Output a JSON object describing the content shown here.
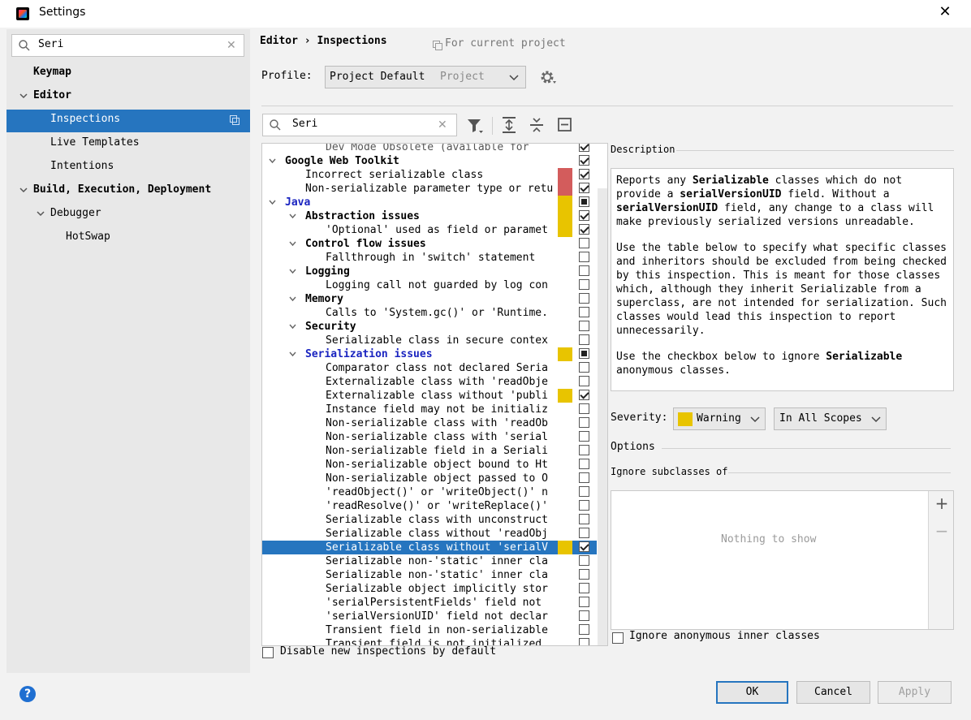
{
  "window": {
    "title": "Settings"
  },
  "sidebar": {
    "search_value": "Seri",
    "items": [
      {
        "label": "Keymap"
      },
      {
        "label": "Editor"
      },
      {
        "label": "Inspections"
      },
      {
        "label": "Live Templates"
      },
      {
        "label": "Intentions"
      },
      {
        "label": "Build, Execution, Deployment"
      },
      {
        "label": "Debugger"
      },
      {
        "label": "HotSwap"
      }
    ]
  },
  "header": {
    "breadcrumb": "Editor › Inspections",
    "scope_note": "For current project",
    "profile_label": "Profile:",
    "profile_value": "Project Default",
    "profile_kind": "Project"
  },
  "tree": {
    "search_value": "Seri",
    "rows": [
      {
        "label": "Dev Mode Obsolete (available for",
        "indent": 3,
        "bold": false,
        "check": "chk",
        "sev": "",
        "cut": true
      },
      {
        "label": "Google Web Toolkit",
        "indent": 1,
        "bold": true,
        "arrow": true,
        "check": "chk",
        "sev": ""
      },
      {
        "label": "Incorrect serializable class",
        "indent": 2,
        "bold": false,
        "check": "chk",
        "sev": "#d35c5c"
      },
      {
        "label": "Non-serializable parameter type or retu",
        "indent": 2,
        "bold": false,
        "check": "chk",
        "sev": "#d35c5c"
      },
      {
        "label": "Java",
        "indent": 1,
        "bold": true,
        "blue": true,
        "arrow": true,
        "check": "partial",
        "sev": "#e8c400"
      },
      {
        "label": "Abstraction issues",
        "indent": 2,
        "bold": true,
        "arrow": true,
        "check": "chk",
        "sev": "#e8c400"
      },
      {
        "label": "'Optional' used as field or paramet",
        "indent": 3,
        "bold": false,
        "check": "chk",
        "sev": "#e8c400"
      },
      {
        "label": "Control flow issues",
        "indent": 2,
        "bold": true,
        "arrow": true,
        "check": "",
        "sev": ""
      },
      {
        "label": "Fallthrough in 'switch' statement",
        "indent": 3,
        "bold": false,
        "check": "",
        "sev": ""
      },
      {
        "label": "Logging",
        "indent": 2,
        "bold": true,
        "arrow": true,
        "check": "",
        "sev": ""
      },
      {
        "label": "Logging call not guarded by log con",
        "indent": 3,
        "bold": false,
        "check": "",
        "sev": ""
      },
      {
        "label": "Memory",
        "indent": 2,
        "bold": true,
        "arrow": true,
        "check": "",
        "sev": ""
      },
      {
        "label": "Calls to 'System.gc()' or 'Runtime.",
        "indent": 3,
        "bold": false,
        "check": "",
        "sev": ""
      },
      {
        "label": "Security",
        "indent": 2,
        "bold": true,
        "arrow": true,
        "check": "",
        "sev": ""
      },
      {
        "label": "Serializable class in secure contex",
        "indent": 3,
        "bold": false,
        "check": "",
        "sev": ""
      },
      {
        "label": "Serialization issues",
        "indent": 2,
        "bold": true,
        "blue": true,
        "arrow": true,
        "check": "partial",
        "sev": "#e8c400"
      },
      {
        "label": "Comparator class not declared Seria",
        "indent": 3,
        "bold": false,
        "check": "",
        "sev": ""
      },
      {
        "label": "Externalizable class with 'readObje",
        "indent": 3,
        "bold": false,
        "check": "",
        "sev": ""
      },
      {
        "label": "Externalizable class without 'publi",
        "indent": 3,
        "bold": false,
        "check": "chk",
        "sev": "#e8c400"
      },
      {
        "label": "Instance field may not be initializ",
        "indent": 3,
        "bold": false,
        "check": "",
        "sev": ""
      },
      {
        "label": "Non-serializable class with 'readOb",
        "indent": 3,
        "bold": false,
        "check": "",
        "sev": ""
      },
      {
        "label": "Non-serializable class with 'serial",
        "indent": 3,
        "bold": false,
        "check": "",
        "sev": ""
      },
      {
        "label": "Non-serializable field in a Seriali",
        "indent": 3,
        "bold": false,
        "check": "",
        "sev": ""
      },
      {
        "label": "Non-serializable object bound to Ht",
        "indent": 3,
        "bold": false,
        "check": "",
        "sev": ""
      },
      {
        "label": "Non-serializable object passed to O",
        "indent": 3,
        "bold": false,
        "check": "",
        "sev": ""
      },
      {
        "label": "'readObject()' or 'writeObject()' n",
        "indent": 3,
        "bold": false,
        "check": "",
        "sev": ""
      },
      {
        "label": "'readResolve()' or 'writeReplace()'",
        "indent": 3,
        "bold": false,
        "check": "",
        "sev": ""
      },
      {
        "label": "Serializable class with unconstruct",
        "indent": 3,
        "bold": false,
        "check": "",
        "sev": ""
      },
      {
        "label": "Serializable class without 'readObj",
        "indent": 3,
        "bold": false,
        "check": "",
        "sev": ""
      },
      {
        "label": "Serializable class without 'serialV",
        "indent": 3,
        "bold": false,
        "check": "chk",
        "sev": "#e8c400",
        "selected": true
      },
      {
        "label": "Serializable non-'static' inner cla",
        "indent": 3,
        "bold": false,
        "check": "",
        "sev": ""
      },
      {
        "label": "Serializable non-'static' inner cla",
        "indent": 3,
        "bold": false,
        "check": "",
        "sev": ""
      },
      {
        "label": "Serializable object implicitly stor",
        "indent": 3,
        "bold": false,
        "check": "",
        "sev": ""
      },
      {
        "label": "'serialPersistentFields' field not",
        "indent": 3,
        "bold": false,
        "check": "",
        "sev": ""
      },
      {
        "label": "'serialVersionUID' field not declar",
        "indent": 3,
        "bold": false,
        "check": "",
        "sev": ""
      },
      {
        "label": "Transient field in non-serializable",
        "indent": 3,
        "bold": false,
        "check": "",
        "sev": ""
      },
      {
        "label": "Transient field is not initialized",
        "indent": 3,
        "bold": false,
        "check": "",
        "sev": ""
      }
    ],
    "disable_new_label": "Disable new inspections by default"
  },
  "description": {
    "title": "Description",
    "p1_pre": "Reports any ",
    "p1_b1": "Serializable",
    "p1_mid": " classes which do not provide a ",
    "p1_b2": "serialVersionUID",
    "p1_mid2": " field. Without a ",
    "p1_b3": "serialVersionUID",
    "p1_post": " field, any change to a class will make previously serialized versions unreadable.",
    "p2": "Use the table below to specify what specific classes and inheritors should be excluded from being checked by this inspection. This is meant for those classes which, although they inherit Serializable from a superclass, are not intended for serialization. Such classes would lead this inspection to report unnecessarily.",
    "p3_pre": "Use the checkbox below to ignore ",
    "p3_b": "Serializable",
    "p3_post": " anonymous classes."
  },
  "severity": {
    "label": "Severity:",
    "value": "Warning",
    "color": "#e8c400",
    "scope": "In All Scopes"
  },
  "options": {
    "title": "Options",
    "subtitle": "Ignore subclasses of",
    "empty_text": "Nothing to show",
    "add_icon": "+",
    "remove_icon": "−",
    "ignore_anon_label": "Ignore anonymous inner classes"
  },
  "footer": {
    "help": "?",
    "ok": "OK",
    "cancel": "Cancel",
    "apply": "Apply"
  }
}
